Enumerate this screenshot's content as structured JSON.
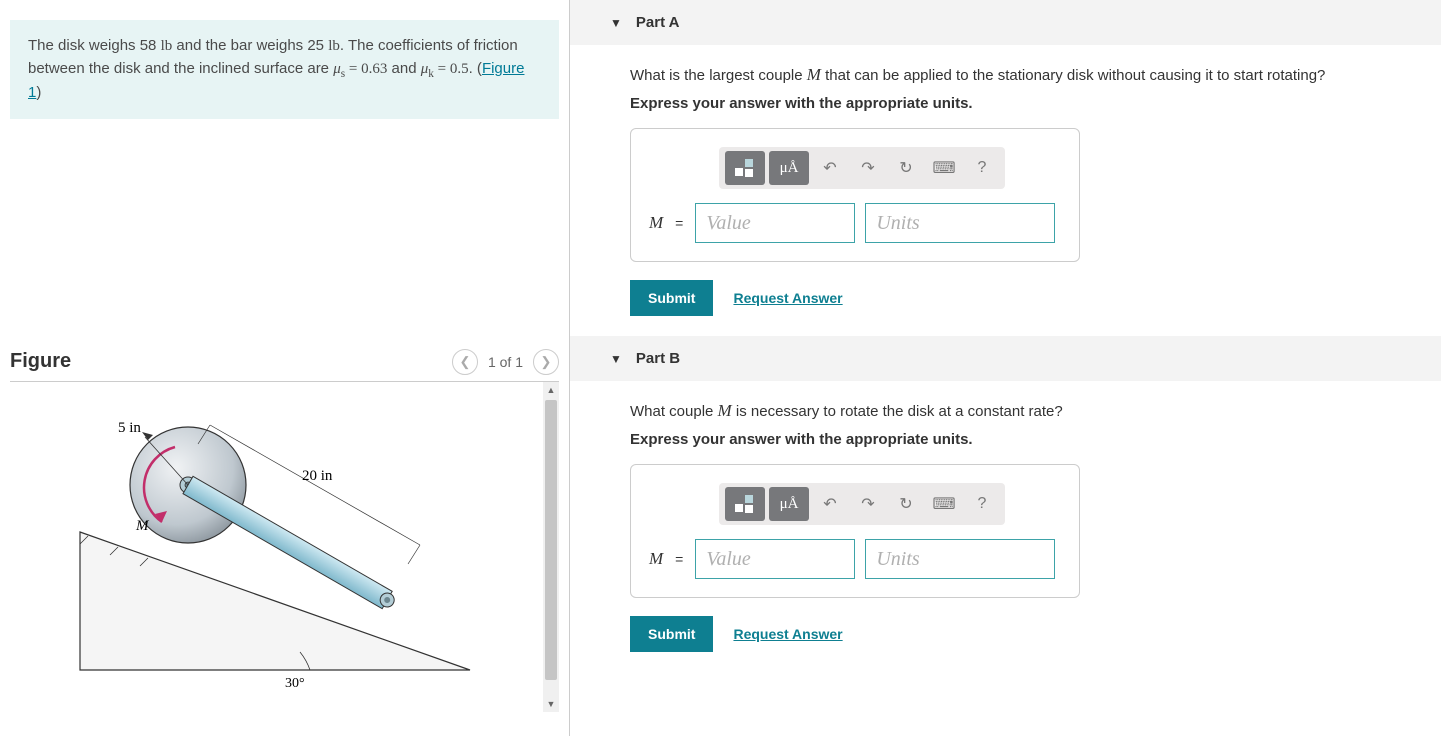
{
  "problem": {
    "text_pre": "The disk weighs ",
    "disk_weight": "58 ",
    "lb1": "lb",
    "text_mid1": " and the bar weighs ",
    "bar_weight": "25 ",
    "lb2": "lb",
    "text_mid2": ". The coefficients of friction between the disk and the inclined surface are ",
    "mu_s_sym": "μ",
    "sub_s": "s",
    "eq1": " = ",
    "mu_s_val": "0.63",
    "and": " and ",
    "mu_k_sym": "μ",
    "sub_k": "k",
    "eq2": " = ",
    "mu_k_val": "0.5",
    "period": ". (",
    "figure_link": "Figure 1",
    "close": ")"
  },
  "figure": {
    "title": "Figure",
    "counter": "1 of 1",
    "dims": {
      "radius": "5 in",
      "bar": "20 in",
      "angle": "30°",
      "moment": "M"
    }
  },
  "parts": [
    {
      "label": "Part A",
      "question_pre": "What is the largest couple ",
      "var": "M",
      "question_post": " that can be applied to the stationary disk without causing it to start rotating?",
      "instruction": "Express your answer with the appropriate units.",
      "input_var": "M",
      "eq": "=",
      "value_placeholder": "Value",
      "units_placeholder": "Units",
      "submit": "Submit",
      "request": "Request Answer",
      "toolbar": {
        "mu": "μÅ",
        "help": "?"
      }
    },
    {
      "label": "Part B",
      "question_pre": "What couple ",
      "var": "M",
      "question_post": " is necessary to rotate the disk at a constant rate?",
      "instruction": "Express your answer with the appropriate units.",
      "input_var": "M",
      "eq": "=",
      "value_placeholder": "Value",
      "units_placeholder": "Units",
      "submit": "Submit",
      "request": "Request Answer",
      "toolbar": {
        "mu": "μÅ",
        "help": "?"
      }
    }
  ]
}
